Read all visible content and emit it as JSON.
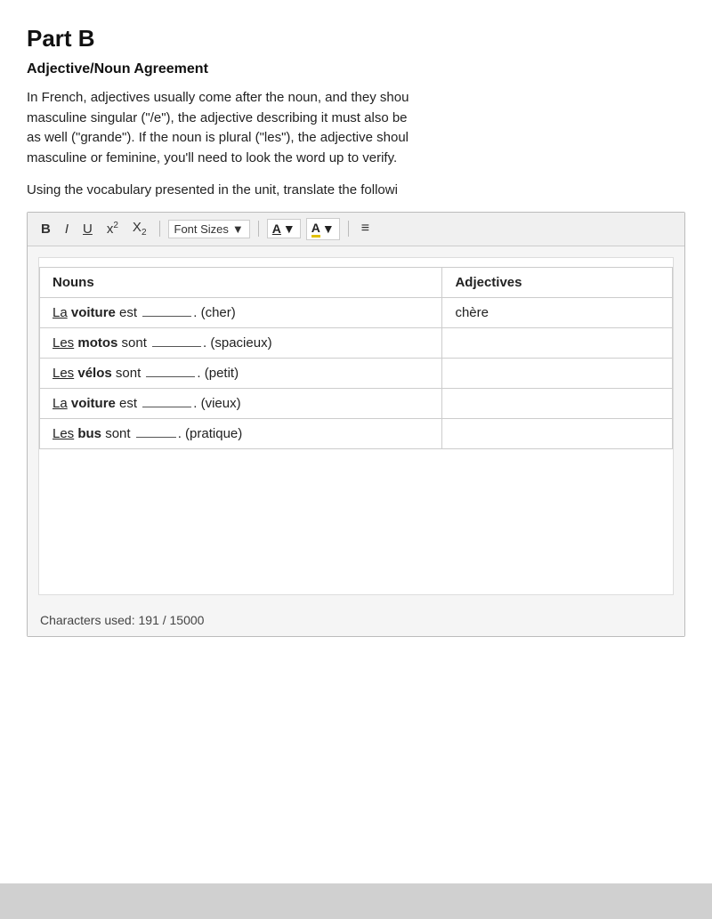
{
  "page": {
    "part_title": "Part B",
    "section_title": "Adjective/Noun Agreement",
    "description": "In French, adjectives usually come after the noun, and they shou masculine singular (\"/e\"), the adjective describing it must also be as well (\"grande\"). If the noun is plural (\"les\"), the adjective shoul masculine or feminine, you'll need to look the word up to verify.",
    "description_line1": "In French, adjectives usually come after the noun, and they shou",
    "description_line2": "masculine singular (\"/e\"), the adjective describing it must also be",
    "description_line3": "as well (\"grande\"). If the noun is plural (\"les\"), the adjective shoul",
    "description_line4": "masculine or feminine, you'll need to look the word up to verify.",
    "instruction": "Using the vocabulary presented in the unit, translate the followi",
    "toolbar": {
      "bold_label": "B",
      "italic_label": "I",
      "underline_label": "U",
      "superscript_label": "x²",
      "subscript_label": "X₂",
      "font_sizes_label": "Font Sizes",
      "font_color_label": "A",
      "font_bg_label": "A",
      "list_label": "≡"
    },
    "table": {
      "col_nouns": "Nouns",
      "col_adjectives": "Adjectives",
      "rows": [
        {
          "noun_prefix_underline": "La",
          "noun_bold": "voiture",
          "noun_rest": " est",
          "blank_length": "55px",
          "hint": "(cher)",
          "adjective": "chère"
        },
        {
          "noun_prefix_underline": "Les",
          "noun_bold": "motos",
          "noun_rest": " sont",
          "blank_length": "55px",
          "hint": "(spacieux)",
          "adjective": ""
        },
        {
          "noun_prefix_underline": "Les",
          "noun_bold": "vélos",
          "noun_rest": " sont",
          "blank_length": "55px",
          "hint": "(petit)",
          "adjective": ""
        },
        {
          "noun_prefix_underline": "La",
          "noun_bold": "voiture",
          "noun_rest": " est",
          "blank_length": "55px",
          "hint": "(vieux)",
          "adjective": ""
        },
        {
          "noun_prefix_underline": "Les",
          "noun_bold": "bus",
          "noun_rest": " sont",
          "blank_length": "45px",
          "hint": "(pratique)",
          "adjective": ""
        }
      ]
    },
    "characters_used": "Characters used: 191 / 15000"
  }
}
